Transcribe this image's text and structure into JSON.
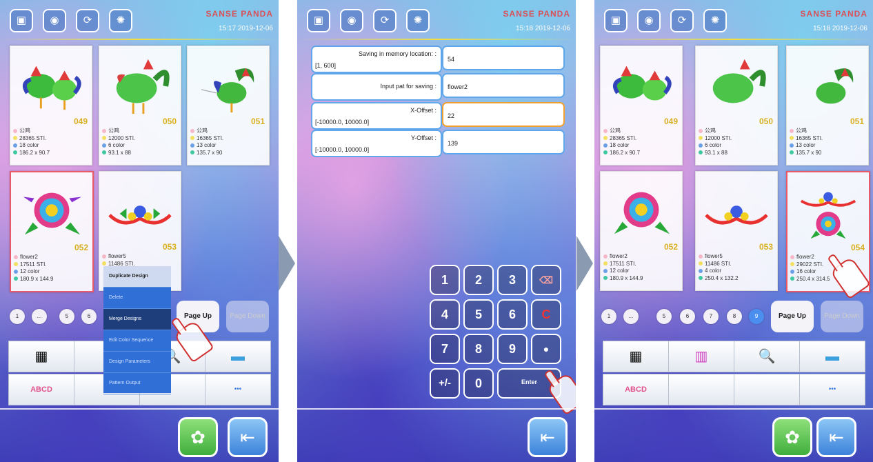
{
  "brand": "SANSE PANDA",
  "top_icons": [
    "grid-icon",
    "thread-icon",
    "sync-icon",
    "bulb-icon"
  ],
  "screen1": {
    "time": "15:17  2019-12-06",
    "cards": [
      {
        "num": "049",
        "name": "公鸡",
        "stitches": "28365 STI.",
        "colors": "18 color",
        "size": "186.2 x 90.7"
      },
      {
        "num": "050",
        "name": "公鸡",
        "stitches": "12000 STI.",
        "colors": "6 color",
        "size": "93.1 x 88"
      },
      {
        "num": "051",
        "name": "公鸡",
        "stitches": "16365 STI.",
        "colors": "13 color",
        "size": "135.7 x 90"
      },
      {
        "num": "052",
        "name": "flower2",
        "stitches": "17511 STI.",
        "colors": "12 color",
        "size": "180.9 x 144.9"
      },
      {
        "num": "053",
        "name": "flower5",
        "stitches": "11486 STI.",
        "colors": "",
        "size": ""
      }
    ],
    "pages": [
      "1",
      "...",
      "5",
      "6"
    ],
    "page_up": "Page Up",
    "page_down": "Page Down",
    "menu": [
      "Duplicate Design",
      "Delete",
      "Merge Designs",
      "Edit Color Sequence",
      "Design Parameters",
      "Pattern Output"
    ],
    "tools": [
      "▦",
      "",
      "🔍",
      "▬",
      "ABCD",
      "",
      "",
      "•••"
    ]
  },
  "screen2": {
    "time": "15:18  2019-12-06",
    "fields": [
      {
        "label": "Saving in memory location: :",
        "range": "[1, 600]",
        "value": "54"
      },
      {
        "label": "Input pat for saving :",
        "range": "",
        "value": "flower2"
      },
      {
        "label": "X-Offset :",
        "range": "[-10000.0, 10000.0]",
        "value": "22"
      },
      {
        "label": "Y-Offset :",
        "range": "[-10000.0, 10000.0]",
        "value": "139"
      }
    ],
    "keys": [
      "1",
      "2",
      "3",
      "⌫",
      "4",
      "5",
      "6",
      "C",
      "7",
      "8",
      "9",
      "●",
      "+/-",
      "0"
    ],
    "enter": "Enter"
  },
  "screen3": {
    "time": "15:18  2019-12-06",
    "cards": [
      {
        "num": "049",
        "name": "公鸡",
        "stitches": "28365 STI.",
        "colors": "18 color",
        "size": "186.2 x 90.7"
      },
      {
        "num": "050",
        "name": "公鸡",
        "stitches": "12000 STI.",
        "colors": "6 color",
        "size": "93.1 x 88"
      },
      {
        "num": "051",
        "name": "公鸡",
        "stitches": "16365 STI.",
        "colors": "13 color",
        "size": "135.7 x 90"
      },
      {
        "num": "052",
        "name": "flower2",
        "stitches": "17511 STI.",
        "colors": "12 color",
        "size": "180.9 x 144.9"
      },
      {
        "num": "053",
        "name": "flower5",
        "stitches": "11486 STI.",
        "colors": "4 color",
        "size": "250.4 x 132.2"
      },
      {
        "num": "054",
        "name": "flower2",
        "stitches": "29022 STI.",
        "colors": "16 color",
        "size": "250.4 x 314.5"
      }
    ],
    "pages": [
      "1",
      "...",
      "5",
      "6",
      "7",
      "8",
      "9"
    ],
    "page_up": "Page Up",
    "page_down": "Page Down",
    "tools": [
      "▦",
      "▥",
      "🔍",
      "▬",
      "ABCD",
      "",
      "",
      "•••"
    ]
  }
}
